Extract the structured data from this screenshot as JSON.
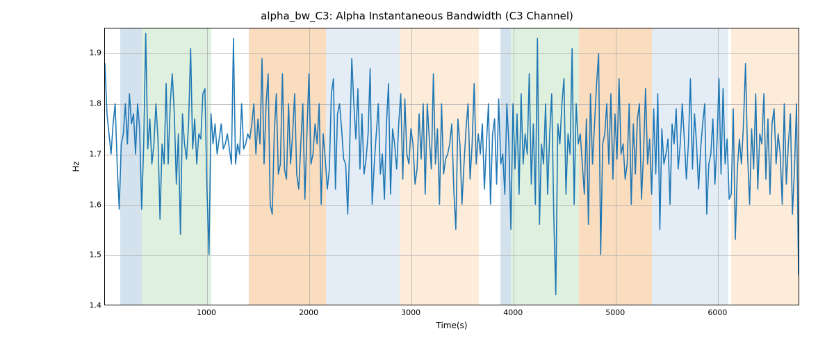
{
  "chart_data": {
    "type": "line",
    "title": "alpha_bw_C3: Alpha Instantaneous Bandwidth (C3 Channel)",
    "xlabel": "Time(s)",
    "ylabel": "Hz",
    "xlim": [
      0,
      6800
    ],
    "ylim": [
      1.4,
      1.95
    ],
    "xticks": [
      1000,
      2000,
      3000,
      4000,
      5000,
      6000
    ],
    "yticks": [
      1.4,
      1.5,
      1.6,
      1.7,
      1.8,
      1.9
    ],
    "bands": [
      {
        "x0": 150,
        "x1": 360,
        "color": "#b7cee3",
        "alpha": 0.6
      },
      {
        "x0": 360,
        "x1": 1040,
        "color": "#c9e6c9",
        "alpha": 0.6
      },
      {
        "x0": 1410,
        "x1": 2160,
        "color": "#f7c795",
        "alpha": 0.6
      },
      {
        "x0": 2160,
        "x1": 2880,
        "color": "#d9e5f2",
        "alpha": 0.7
      },
      {
        "x0": 2880,
        "x1": 3660,
        "color": "#fce4c9",
        "alpha": 0.7
      },
      {
        "x0": 3870,
        "x1": 3970,
        "color": "#b7cee3",
        "alpha": 0.6
      },
      {
        "x0": 3970,
        "x1": 4640,
        "color": "#c9e6c9",
        "alpha": 0.6
      },
      {
        "x0": 4640,
        "x1": 5350,
        "color": "#f7c795",
        "alpha": 0.6
      },
      {
        "x0": 5350,
        "x1": 6100,
        "color": "#d9e5f2",
        "alpha": 0.7
      },
      {
        "x0": 6100,
        "x1": 6130,
        "color": "#ffffff",
        "alpha": 0.0
      },
      {
        "x0": 6130,
        "x1": 6800,
        "color": "#fce4c9",
        "alpha": 0.7
      }
    ],
    "series": [
      {
        "name": "alpha_bw_C3",
        "color": "#1f77b4",
        "x_step": 20,
        "x_start": 0,
        "values": [
          1.88,
          1.78,
          1.74,
          1.7,
          1.76,
          1.8,
          1.68,
          1.59,
          1.72,
          1.74,
          1.8,
          1.72,
          1.82,
          1.76,
          1.78,
          1.7,
          1.8,
          1.75,
          1.59,
          1.72,
          1.94,
          1.71,
          1.77,
          1.68,
          1.72,
          1.8,
          1.73,
          1.57,
          1.72,
          1.68,
          1.84,
          1.68,
          1.8,
          1.86,
          1.78,
          1.64,
          1.74,
          1.54,
          1.78,
          1.72,
          1.69,
          1.76,
          1.91,
          1.71,
          1.77,
          1.68,
          1.74,
          1.73,
          1.82,
          1.83,
          1.63,
          1.5,
          1.78,
          1.72,
          1.76,
          1.7,
          1.73,
          1.76,
          1.71,
          1.72,
          1.74,
          1.71,
          1.68,
          1.93,
          1.68,
          1.72,
          1.7,
          1.8,
          1.71,
          1.72,
          1.74,
          1.73,
          1.76,
          1.8,
          1.7,
          1.77,
          1.72,
          1.89,
          1.68,
          1.8,
          1.86,
          1.6,
          1.58,
          1.74,
          1.82,
          1.66,
          1.68,
          1.86,
          1.67,
          1.65,
          1.8,
          1.68,
          1.74,
          1.82,
          1.66,
          1.63,
          1.72,
          1.8,
          1.61,
          1.74,
          1.86,
          1.68,
          1.7,
          1.76,
          1.72,
          1.8,
          1.6,
          1.74,
          1.69,
          1.63,
          1.67,
          1.82,
          1.85,
          1.63,
          1.78,
          1.8,
          1.75,
          1.69,
          1.68,
          1.58,
          1.72,
          1.89,
          1.8,
          1.73,
          1.83,
          1.67,
          1.78,
          1.66,
          1.69,
          1.74,
          1.87,
          1.6,
          1.68,
          1.74,
          1.8,
          1.66,
          1.7,
          1.61,
          1.76,
          1.84,
          1.62,
          1.75,
          1.72,
          1.67,
          1.76,
          1.82,
          1.65,
          1.81,
          1.7,
          1.68,
          1.75,
          1.72,
          1.64,
          1.67,
          1.78,
          1.69,
          1.8,
          1.62,
          1.8,
          1.73,
          1.67,
          1.86,
          1.68,
          1.75,
          1.6,
          1.8,
          1.66,
          1.69,
          1.7,
          1.72,
          1.76,
          1.63,
          1.55,
          1.77,
          1.72,
          1.6,
          1.68,
          1.75,
          1.8,
          1.65,
          1.72,
          1.84,
          1.68,
          1.74,
          1.7,
          1.76,
          1.63,
          1.72,
          1.8,
          1.6,
          1.74,
          1.77,
          1.64,
          1.81,
          1.68,
          1.7,
          1.62,
          1.8,
          1.72,
          1.55,
          1.8,
          1.67,
          1.78,
          1.62,
          1.82,
          1.68,
          1.74,
          1.7,
          1.86,
          1.64,
          1.76,
          1.6,
          1.93,
          1.56,
          1.72,
          1.68,
          1.8,
          1.62,
          1.74,
          1.82,
          1.58,
          1.42,
          1.76,
          1.72,
          1.8,
          1.85,
          1.62,
          1.74,
          1.7,
          1.91,
          1.6,
          1.8,
          1.72,
          1.74,
          1.68,
          1.62,
          1.77,
          1.56,
          1.82,
          1.68,
          1.76,
          1.84,
          1.9,
          1.5,
          1.72,
          1.74,
          1.8,
          1.68,
          1.82,
          1.65,
          1.78,
          1.69,
          1.85,
          1.7,
          1.72,
          1.65,
          1.68,
          1.8,
          1.6,
          1.76,
          1.66,
          1.77,
          1.8,
          1.61,
          1.7,
          1.83,
          1.68,
          1.73,
          1.62,
          1.79,
          1.66,
          1.82,
          1.55,
          1.75,
          1.68,
          1.7,
          1.73,
          1.6,
          1.76,
          1.72,
          1.79,
          1.67,
          1.72,
          1.8,
          1.73,
          1.65,
          1.72,
          1.85,
          1.67,
          1.78,
          1.72,
          1.63,
          1.71,
          1.76,
          1.8,
          1.58,
          1.68,
          1.7,
          1.77,
          1.64,
          1.72,
          1.85,
          1.66,
          1.83,
          1.68,
          1.73,
          1.61,
          1.62,
          1.79,
          1.53,
          1.67,
          1.73,
          1.68,
          1.76,
          1.88,
          1.7,
          1.6,
          1.75,
          1.67,
          1.82,
          1.63,
          1.74,
          1.72,
          1.82,
          1.65,
          1.77,
          1.62,
          1.76,
          1.79,
          1.68,
          1.74,
          1.7,
          1.6,
          1.8,
          1.64,
          1.72,
          1.78,
          1.58,
          1.67,
          1.8,
          1.46
        ]
      }
    ]
  }
}
